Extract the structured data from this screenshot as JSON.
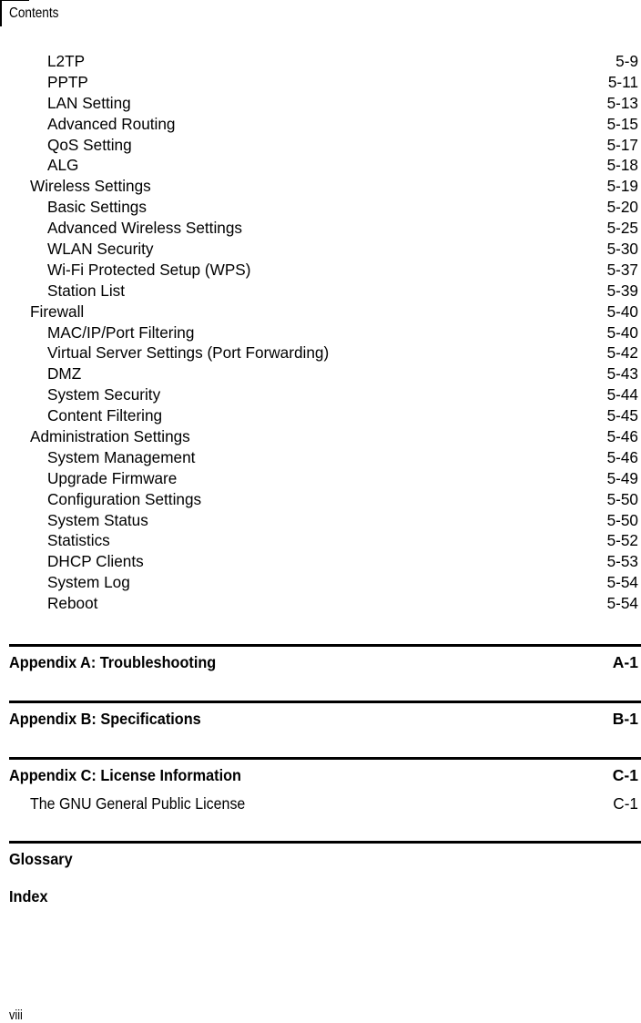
{
  "header": {
    "title": "Contents"
  },
  "entries": [
    {
      "level": 2,
      "label": "L2TP",
      "page": "5-9"
    },
    {
      "level": 2,
      "label": "PPTP",
      "page": "5-11"
    },
    {
      "level": 2,
      "label": "LAN Setting",
      "page": "5-13"
    },
    {
      "level": 2,
      "label": "Advanced Routing",
      "page": "5-15"
    },
    {
      "level": 2,
      "label": "QoS Setting",
      "page": "5-17"
    },
    {
      "level": 2,
      "label": "ALG",
      "page": "5-18"
    },
    {
      "level": 1,
      "label": "Wireless Settings",
      "page": "5-19"
    },
    {
      "level": 2,
      "label": "Basic Settings",
      "page": "5-20"
    },
    {
      "level": 2,
      "label": "Advanced Wireless Settings",
      "page": "5-25"
    },
    {
      "level": 2,
      "label": "WLAN Security",
      "page": "5-30"
    },
    {
      "level": 2,
      "label": "Wi-Fi Protected Setup (WPS)",
      "page": "5-37"
    },
    {
      "level": 2,
      "label": "Station List",
      "page": "5-39"
    },
    {
      "level": 1,
      "label": "Firewall",
      "page": "5-40"
    },
    {
      "level": 2,
      "label": "MAC/IP/Port Filtering",
      "page": "5-40"
    },
    {
      "level": 2,
      "label": "Virtual Server Settings (Port Forwarding)",
      "page": "5-42"
    },
    {
      "level": 2,
      "label": "DMZ",
      "page": "5-43"
    },
    {
      "level": 2,
      "label": "System Security",
      "page": "5-44"
    },
    {
      "level": 2,
      "label": "Content Filtering",
      "page": "5-45"
    },
    {
      "level": 1,
      "label": "Administration Settings",
      "page": "5-46"
    },
    {
      "level": 2,
      "label": "System Management",
      "page": "5-46"
    },
    {
      "level": 2,
      "label": "Upgrade Firmware",
      "page": "5-49"
    },
    {
      "level": 2,
      "label": "Configuration Settings",
      "page": "5-50"
    },
    {
      "level": 2,
      "label": "System Status",
      "page": "5-50"
    },
    {
      "level": 2,
      "label": "Statistics",
      "page": "5-52"
    },
    {
      "level": 2,
      "label": "DHCP Clients",
      "page": "5-53"
    },
    {
      "level": 2,
      "label": "System Log",
      "page": "5-54"
    },
    {
      "level": 2,
      "label": "Reboot",
      "page": "5-54"
    }
  ],
  "appendices": [
    {
      "label": "Appendix A: Troubleshooting",
      "page": "A-1"
    },
    {
      "label": "Appendix B: Specifications",
      "page": "B-1"
    },
    {
      "label": "Appendix C: License Information",
      "page": "C-1",
      "sub": {
        "label": "The GNU General Public License",
        "page": "C-1"
      }
    }
  ],
  "glossary": {
    "label": "Glossary"
  },
  "index": {
    "label": "Index"
  },
  "footer": {
    "page_number": "viii"
  }
}
